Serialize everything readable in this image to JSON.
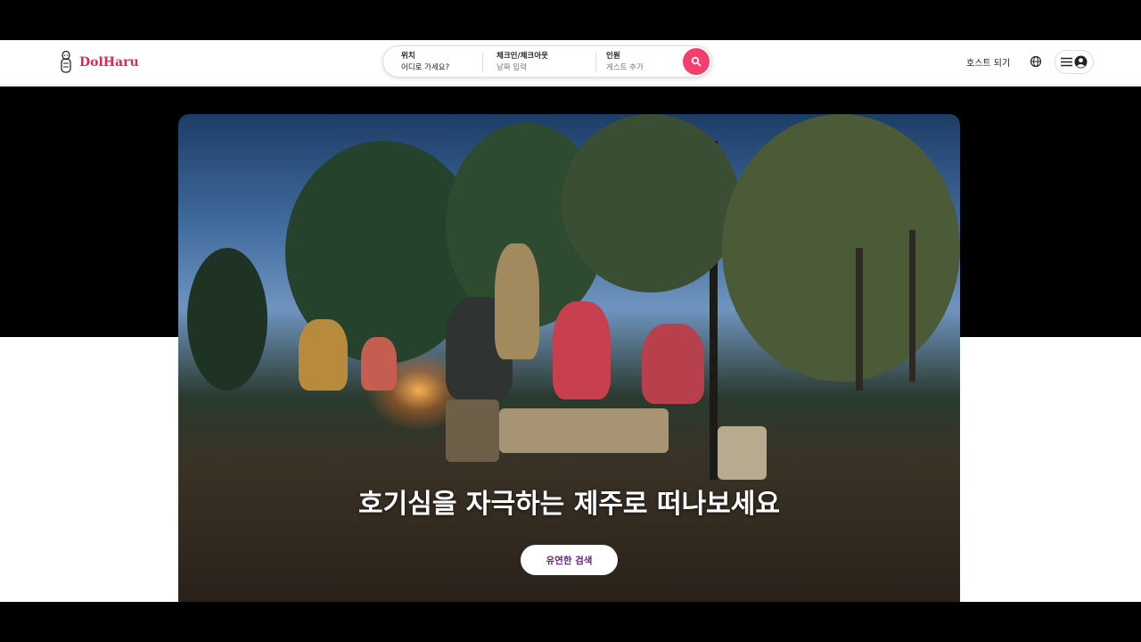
{
  "brand": {
    "name": "DolHaru",
    "accent": "#e0245e",
    "search_color": "#f43f6c"
  },
  "search": {
    "location_label": "위치",
    "location_value": "어디로 가세요?",
    "dates_label": "체크인/체크아웃",
    "dates_value": "날짜 입력",
    "guests_label": "인원",
    "guests_value": "게스트 추가",
    "button_icon": "search-icon"
  },
  "nav": {
    "host_label": "호스트 되기",
    "globe_icon": "globe-icon",
    "menu_icon": "hamburger-icon",
    "profile_icon": "user-circle-icon"
  },
  "hero": {
    "title": "호기심을 자극하는 제주로 떠나보세요",
    "button_label": "유연한 검색",
    "button_text_color": "#6b1d7a"
  }
}
